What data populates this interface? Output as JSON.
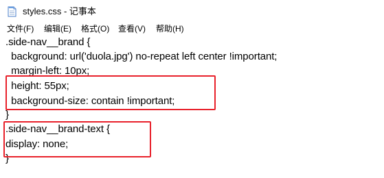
{
  "window": {
    "title": "styles.css - 记事本",
    "icon": "notepad-file-icon"
  },
  "menu": {
    "items": [
      {
        "label": "文件(F)"
      },
      {
        "label": "编辑(E)"
      },
      {
        "label": "格式(O)"
      },
      {
        "label": "查看(V)"
      },
      {
        "label": "帮助(H)"
      }
    ]
  },
  "editor": {
    "lines": [
      ".side-nav__brand {",
      "  background: url('duola.jpg') no-repeat left center !important;",
      "  margin-left: 10px;",
      "  height: 55px;",
      "  background-size: contain !important;",
      "}",
      ".side-nav__brand-text {",
      "display: none;",
      "}"
    ]
  },
  "colors": {
    "highlight_border": "#e8202a",
    "background": "#ffffff",
    "text": "#000000"
  }
}
